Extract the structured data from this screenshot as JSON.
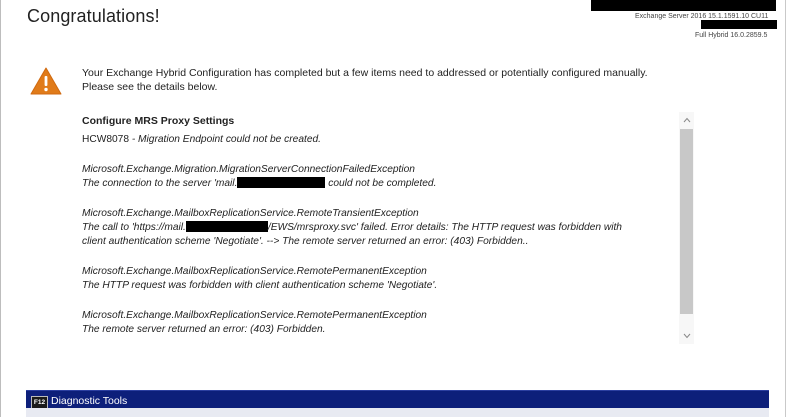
{
  "header": {
    "title": "Congratulations!",
    "server_version": "Exchange Server 2016 15.1.1591.10 CU11",
    "hybrid_version": "Full Hybrid 16.0.2859.5"
  },
  "intro": {
    "icon": "warning-triangle-icon",
    "line1": "Your Exchange Hybrid Configuration has completed but a few items need to addressed or potentially configured manually.",
    "line2": "Please see the details below."
  },
  "details": {
    "section_title": "Configure MRS Proxy Settings",
    "hcw_code": "HCW8078",
    "hcw_message": " - Migration Endpoint could not be created.",
    "errors": [
      {
        "exception": "Microsoft.Exchange.Migration.MigrationServerConnectionFailedException",
        "msg_prefix": "The connection to the server 'mail.",
        "msg_suffix": " could not be completed."
      },
      {
        "exception": "Microsoft.Exchange.MailboxReplicationService.RemoteTransientException",
        "msg_prefix": "The call to 'https://mail.",
        "msg_suffix": "/EWS/mrsproxy.svc' failed. Error details: The HTTP request was forbidden with",
        "msg_line2": "client authentication scheme 'Negotiate'. --> The remote server returned an error: (403) Forbidden.."
      },
      {
        "exception": "Microsoft.Exchange.MailboxReplicationService.RemotePermanentException",
        "message": "The HTTP request was forbidden with client authentication scheme 'Negotiate'."
      },
      {
        "exception": "Microsoft.Exchange.MailboxReplicationService.RemotePermanentException",
        "message": "The remote server returned an error: (403) Forbidden."
      }
    ],
    "scroll_up_icon": "chevron-up-icon",
    "scroll_down_icon": "chevron-down-icon"
  },
  "diagnostics": {
    "badge": "F12",
    "title": "Diagnostic Tools"
  },
  "colors": {
    "warning": "#e07b1a",
    "diag_bar": "#0d1f7a"
  }
}
